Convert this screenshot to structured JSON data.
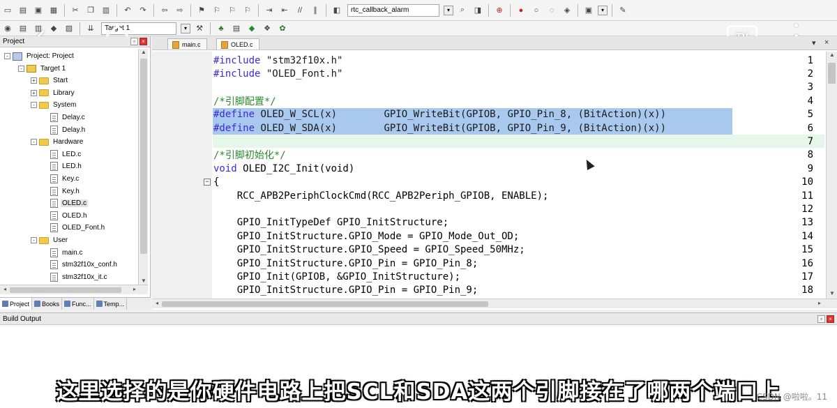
{
  "toolbar": {
    "target_combo_label": "rtc_callback_alarm",
    "build_target_label": "Target 1"
  },
  "project_panel": {
    "title": "Project",
    "tree": [
      {
        "label": "Project: Project",
        "type": "project",
        "depth": 0,
        "expander": "-"
      },
      {
        "label": "Target 1",
        "type": "target",
        "depth": 1,
        "expander": "-"
      },
      {
        "label": "Start",
        "type": "folder",
        "depth": 2,
        "expander": "+"
      },
      {
        "label": "Library",
        "type": "folder",
        "depth": 2,
        "expander": "+"
      },
      {
        "label": "System",
        "type": "folder",
        "depth": 2,
        "expander": "-"
      },
      {
        "label": "Delay.c",
        "type": "file",
        "depth": 3
      },
      {
        "label": "Delay.h",
        "type": "file",
        "depth": 3
      },
      {
        "label": "Hardware",
        "type": "folder",
        "depth": 2,
        "expander": "-"
      },
      {
        "label": "LED.c",
        "type": "file",
        "depth": 3
      },
      {
        "label": "LED.h",
        "type": "file",
        "depth": 3
      },
      {
        "label": "Key.c",
        "type": "file",
        "depth": 3
      },
      {
        "label": "Key.h",
        "type": "file",
        "depth": 3
      },
      {
        "label": "OLED.c",
        "type": "file",
        "depth": 3,
        "selected": true
      },
      {
        "label": "OLED.h",
        "type": "file",
        "depth": 3
      },
      {
        "label": "OLED_Font.h",
        "type": "file",
        "depth": 3
      },
      {
        "label": "User",
        "type": "folder",
        "depth": 2,
        "expander": "-"
      },
      {
        "label": "main.c",
        "type": "file",
        "depth": 3
      },
      {
        "label": "stm32f10x_conf.h",
        "type": "file",
        "depth": 3
      },
      {
        "label": "stm32f10x_it.c",
        "type": "file",
        "depth": 3
      }
    ],
    "tabs": [
      {
        "label": "Project",
        "active": true
      },
      {
        "label": "Books",
        "active": false
      },
      {
        "label": "Func...",
        "active": false
      },
      {
        "label": "Temp...",
        "active": false
      }
    ]
  },
  "editor": {
    "tabs": [
      {
        "label": "main.c",
        "active": false
      },
      {
        "label": "OLED.c",
        "active": true
      }
    ],
    "lines": [
      {
        "no": "1",
        "text": "#include \"stm32f10x.h\"",
        "kind": "include"
      },
      {
        "no": "2",
        "text": "#include \"OLED_Font.h\"",
        "kind": "include"
      },
      {
        "no": "3",
        "text": "",
        "kind": "plain"
      },
      {
        "no": "4",
        "text": "/*引脚配置*/",
        "kind": "comment"
      },
      {
        "no": "5",
        "text": "#define OLED_W_SCL(x)        GPIO_WriteBit(GPIOB, GPIO_Pin_8, (BitAction)(x))",
        "kind": "define",
        "selected": true
      },
      {
        "no": "6",
        "text": "#define OLED_W_SDA(x)        GPIO_WriteBit(GPIOB, GPIO_Pin_9, (BitAction)(x))",
        "kind": "define",
        "selected": true
      },
      {
        "no": "7",
        "text": "",
        "kind": "plain",
        "current": true
      },
      {
        "no": "8",
        "text": "/*引脚初始化*/",
        "kind": "comment"
      },
      {
        "no": "9",
        "text": "void OLED_I2C_Init(void)",
        "kind": "func"
      },
      {
        "no": "10",
        "text": "{",
        "kind": "plain",
        "fold": "⊟"
      },
      {
        "no": "11",
        "text": "    RCC_APB2PeriphClockCmd(RCC_APB2Periph_GPIOB, ENABLE);",
        "kind": "plain"
      },
      {
        "no": "12",
        "text": "",
        "kind": "plain"
      },
      {
        "no": "13",
        "text": "    GPIO_InitTypeDef GPIO_InitStructure;",
        "kind": "plain"
      },
      {
        "no": "14",
        "text": "    GPIO_InitStructure.GPIO_Mode = GPIO_Mode_Out_OD;",
        "kind": "plain"
      },
      {
        "no": "15",
        "text": "    GPIO_InitStructure.GPIO_Speed = GPIO_Speed_50MHz;",
        "kind": "plain"
      },
      {
        "no": "16",
        "text": "    GPIO_InitStructure.GPIO_Pin = GPIO_Pin_8;",
        "kind": "plain"
      },
      {
        "no": "17",
        "text": "    GPIO_Init(GPIOB, &GPIO_InitStructure);",
        "kind": "plain"
      },
      {
        "no": "18",
        "text": "    GPIO_InitStructure.GPIO_Pin = GPIO_Pin_9;",
        "kind": "plain"
      }
    ]
  },
  "build_output": {
    "title": "Build Output"
  },
  "overlay": {
    "tv_label": "TV",
    "subtitle": "这里选择的是你硬件电路上把SCL和SDA这两个引脚接在了哪两个端口上",
    "watermark": "CSDN @啦啦。11"
  },
  "colors": {
    "keyword": "#3b2bd6",
    "comment": "#2b8a2b",
    "selection": "#a8c8ee",
    "current_line": "#e6f6e8"
  }
}
